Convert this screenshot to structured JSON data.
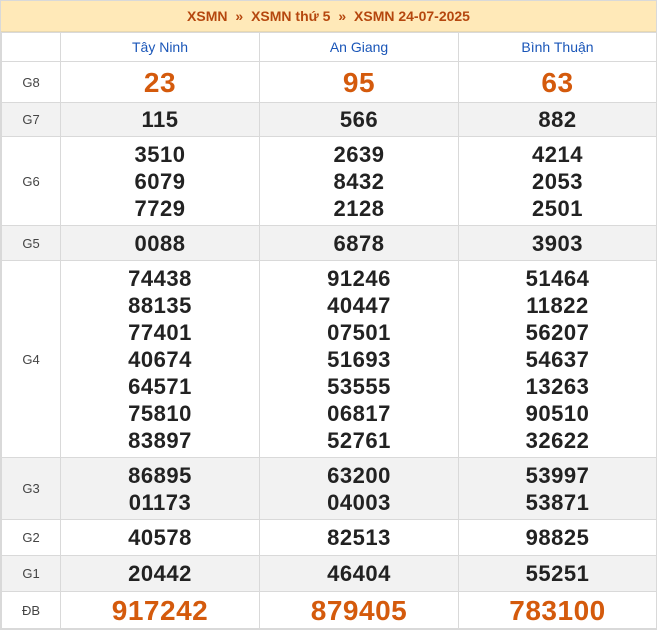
{
  "breadcrumb": {
    "part1": "XSMN",
    "sep1": "»",
    "part2": "XSMN thứ 5",
    "sep2": "»",
    "part3": "XSMN 24-07-2025"
  },
  "columns": [
    "Tây Ninh",
    "An Giang",
    "Bình Thuận"
  ],
  "prizes": {
    "g8": {
      "label": "G8",
      "values": [
        [
          "23"
        ],
        [
          "95"
        ],
        [
          "63"
        ]
      ]
    },
    "g7": {
      "label": "G7",
      "values": [
        [
          "115"
        ],
        [
          "566"
        ],
        [
          "882"
        ]
      ]
    },
    "g6": {
      "label": "G6",
      "values": [
        [
          "3510",
          "6079",
          "7729"
        ],
        [
          "2639",
          "8432",
          "2128"
        ],
        [
          "4214",
          "2053",
          "2501"
        ]
      ]
    },
    "g5": {
      "label": "G5",
      "values": [
        [
          "0088"
        ],
        [
          "6878"
        ],
        [
          "3903"
        ]
      ]
    },
    "g4": {
      "label": "G4",
      "values": [
        [
          "74438",
          "88135",
          "77401",
          "40674",
          "64571",
          "75810",
          "83897"
        ],
        [
          "91246",
          "40447",
          "07501",
          "51693",
          "53555",
          "06817",
          "52761"
        ],
        [
          "51464",
          "11822",
          "56207",
          "54637",
          "13263",
          "90510",
          "32622"
        ]
      ]
    },
    "g3": {
      "label": "G3",
      "values": [
        [
          "86895",
          "01173"
        ],
        [
          "63200",
          "04003"
        ],
        [
          "53997",
          "53871"
        ]
      ]
    },
    "g2": {
      "label": "G2",
      "values": [
        [
          "40578"
        ],
        [
          "82513"
        ],
        [
          "98825"
        ]
      ]
    },
    "g1": {
      "label": "G1",
      "values": [
        [
          "20442"
        ],
        [
          "46404"
        ],
        [
          "55251"
        ]
      ]
    },
    "db": {
      "label": "ĐB",
      "values": [
        [
          "917242"
        ],
        [
          "879405"
        ],
        [
          "783100"
        ]
      ]
    }
  },
  "colors": {
    "header_bg": "#ffe9b8",
    "accent": "#d45a0c",
    "province": "#1a56b8",
    "alt_row": "#f2f2f2"
  }
}
